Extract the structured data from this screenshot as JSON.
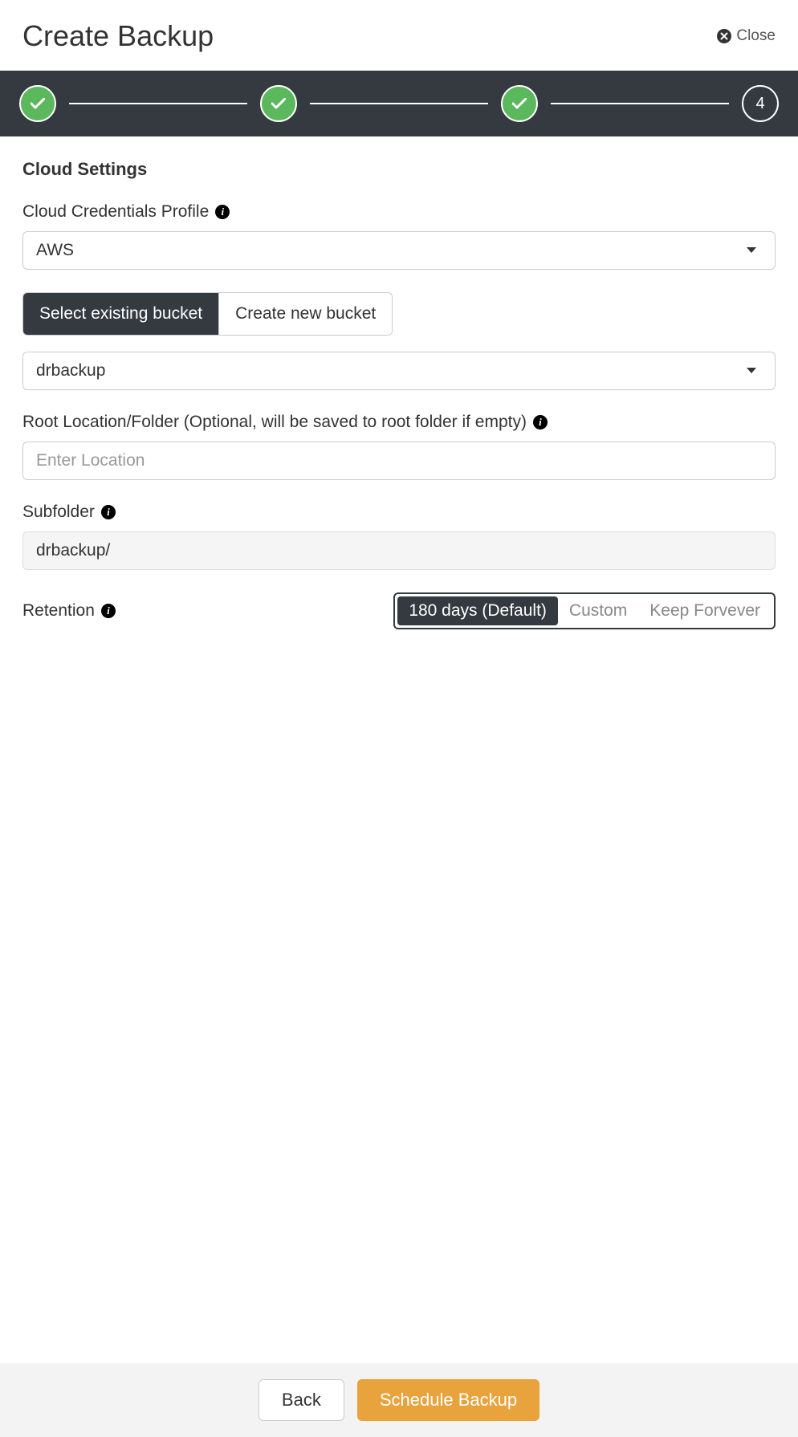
{
  "header": {
    "title": "Create Backup",
    "close_label": "Close"
  },
  "stepper": {
    "current_step": "4"
  },
  "section": {
    "title": "Cloud Settings"
  },
  "credentials": {
    "label": "Cloud Credentials Profile",
    "value": "AWS"
  },
  "bucket_mode": {
    "existing_label": "Select existing bucket",
    "create_label": "Create new bucket"
  },
  "bucket_select": {
    "value": "drbackup"
  },
  "root_location": {
    "label": "Root Location/Folder (Optional, will be saved to root folder if empty)",
    "placeholder": "Enter Location",
    "value": ""
  },
  "subfolder": {
    "label": "Subfolder",
    "value": "drbackup/"
  },
  "retention": {
    "label": "Retention",
    "options": {
      "default": "180 days (Default)",
      "custom": "Custom",
      "keep": "Keep Forvever"
    }
  },
  "footer": {
    "back_label": "Back",
    "submit_label": "Schedule Backup"
  }
}
